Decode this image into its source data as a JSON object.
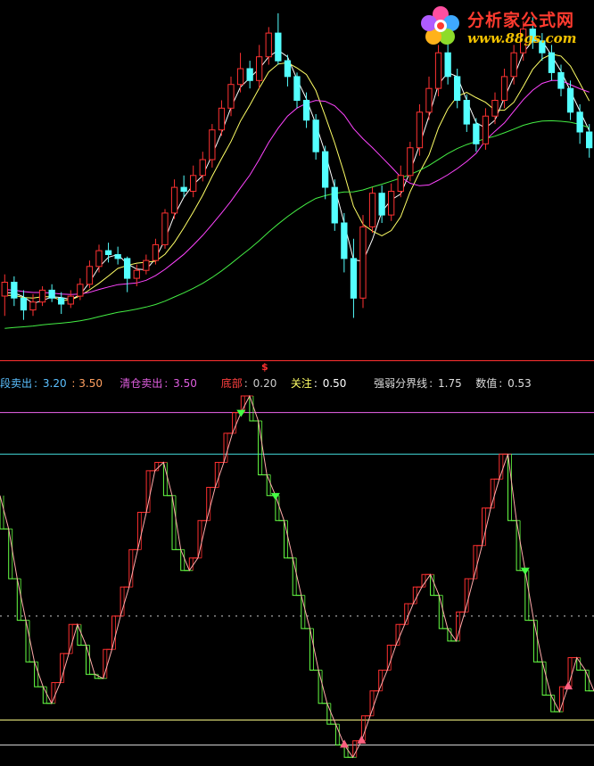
{
  "watermark": {
    "title": "分析家公式网",
    "url": "www.88gs.com",
    "colors": {
      "title": "#ff3b2f",
      "url": "#f2c200"
    }
  },
  "marker": {
    "symbol": "$"
  },
  "indicator": {
    "legend": [
      {
        "label": "段卖出",
        "sep": ": ",
        "value": "3.20",
        "extra": ": 3.50",
        "label_color": "#5bc0ff",
        "value_color": "#5bc0ff"
      },
      {
        "label": "清仓卖出",
        "sep": ": ",
        "value": "3.50",
        "label_color": "#e05ee0",
        "value_color": "#e05ee0"
      },
      {
        "label": "底部",
        "sep": ": ",
        "value": "0.20",
        "label_color": "#ff4040",
        "value_color": "#cccccc"
      },
      {
        "label": "关注",
        "sep": ": ",
        "value": "0.50",
        "label_color": "#ffff66",
        "value_color": "#ffffff"
      },
      {
        "label": "强弱分界线",
        "sep": ": ",
        "value": "1.75",
        "label_color": "#dddddd",
        "value_color": "#dddddd"
      },
      {
        "label": "数值",
        "sep": ": ",
        "value": "0.53",
        "label_color": "#dddddd",
        "value_color": "#dddddd"
      }
    ]
  },
  "chart_data": [
    {
      "type": "candlestick",
      "colors": {
        "up": "#ff3232",
        "down": "#54ffff",
        "ma_white": "#ffffff",
        "ma_yellow": "#ffff66",
        "ma_magenta": "#ff44ff",
        "ma_green": "#44ee44"
      },
      "candles": [
        {
          "o": 5.3,
          "c": 6.0,
          "h": 6.4,
          "l": 4.3
        },
        {
          "o": 6.0,
          "c": 5.2,
          "h": 6.3,
          "l": 4.8
        },
        {
          "o": 5.2,
          "c": 4.6,
          "h": 5.6,
          "l": 4.1
        },
        {
          "o": 4.6,
          "c": 5.0,
          "h": 5.4,
          "l": 4.3
        },
        {
          "o": 5.0,
          "c": 5.6,
          "h": 5.8,
          "l": 4.8
        },
        {
          "o": 5.6,
          "c": 5.2,
          "h": 5.9,
          "l": 5.0
        },
        {
          "o": 5.2,
          "c": 4.9,
          "h": 5.5,
          "l": 4.4
        },
        {
          "o": 4.9,
          "c": 5.3,
          "h": 5.6,
          "l": 4.7
        },
        {
          "o": 5.3,
          "c": 5.9,
          "h": 6.2,
          "l": 5.1
        },
        {
          "o": 5.9,
          "c": 6.8,
          "h": 7.1,
          "l": 5.7
        },
        {
          "o": 6.8,
          "c": 7.6,
          "h": 7.9,
          "l": 6.5
        },
        {
          "o": 7.6,
          "c": 7.4,
          "h": 8.0,
          "l": 7.0
        },
        {
          "o": 7.4,
          "c": 7.2,
          "h": 7.8,
          "l": 6.9
        },
        {
          "o": 7.2,
          "c": 6.2,
          "h": 7.3,
          "l": 5.5
        },
        {
          "o": 6.2,
          "c": 6.6,
          "h": 6.9,
          "l": 5.8
        },
        {
          "o": 6.6,
          "c": 7.1,
          "h": 7.4,
          "l": 6.4
        },
        {
          "o": 7.1,
          "c": 7.9,
          "h": 8.2,
          "l": 6.9
        },
        {
          "o": 7.9,
          "c": 9.5,
          "h": 9.7,
          "l": 7.7
        },
        {
          "o": 9.5,
          "c": 10.8,
          "h": 11.2,
          "l": 9.2
        },
        {
          "o": 10.8,
          "c": 10.6,
          "h": 11.4,
          "l": 10.3
        },
        {
          "o": 10.6,
          "c": 11.4,
          "h": 11.9,
          "l": 10.3
        },
        {
          "o": 11.4,
          "c": 12.2,
          "h": 12.6,
          "l": 11.1
        },
        {
          "o": 12.2,
          "c": 13.7,
          "h": 14.0,
          "l": 11.8
        },
        {
          "o": 13.7,
          "c": 14.8,
          "h": 15.2,
          "l": 13.4
        },
        {
          "o": 14.8,
          "c": 16.0,
          "h": 16.4,
          "l": 14.4
        },
        {
          "o": 16.0,
          "c": 16.8,
          "h": 17.6,
          "l": 15.6
        },
        {
          "o": 16.8,
          "c": 16.2,
          "h": 17.2,
          "l": 15.8
        },
        {
          "o": 16.2,
          "c": 17.4,
          "h": 18.0,
          "l": 15.8
        },
        {
          "o": 17.4,
          "c": 18.6,
          "h": 18.9,
          "l": 17.0
        },
        {
          "o": 18.6,
          "c": 17.2,
          "h": 19.6,
          "l": 17.0
        },
        {
          "o": 17.2,
          "c": 16.4,
          "h": 17.5,
          "l": 15.9
        },
        {
          "o": 16.4,
          "c": 15.2,
          "h": 16.6,
          "l": 14.8
        },
        {
          "o": 15.2,
          "c": 14.2,
          "h": 15.6,
          "l": 13.8
        },
        {
          "o": 14.2,
          "c": 12.6,
          "h": 14.5,
          "l": 12.2
        },
        {
          "o": 12.6,
          "c": 10.8,
          "h": 12.9,
          "l": 10.2
        },
        {
          "o": 10.8,
          "c": 9.0,
          "h": 11.2,
          "l": 8.6
        },
        {
          "o": 9.0,
          "c": 7.2,
          "h": 9.5,
          "l": 6.5
        },
        {
          "o": 7.2,
          "c": 5.2,
          "h": 8.2,
          "l": 4.2
        },
        {
          "o": 5.2,
          "c": 8.8,
          "h": 9.4,
          "l": 4.7
        },
        {
          "o": 8.8,
          "c": 10.5,
          "h": 10.8,
          "l": 8.5
        },
        {
          "o": 10.5,
          "c": 9.4,
          "h": 10.9,
          "l": 9.0
        },
        {
          "o": 9.4,
          "c": 10.6,
          "h": 11.0,
          "l": 9.1
        },
        {
          "o": 10.6,
          "c": 11.4,
          "h": 11.9,
          "l": 10.3
        },
        {
          "o": 11.4,
          "c": 12.8,
          "h": 13.1,
          "l": 11.1
        },
        {
          "o": 12.8,
          "c": 14.6,
          "h": 15.0,
          "l": 12.4
        },
        {
          "o": 14.6,
          "c": 15.8,
          "h": 16.4,
          "l": 14.2
        },
        {
          "o": 15.8,
          "c": 17.6,
          "h": 18.0,
          "l": 15.4
        },
        {
          "o": 17.6,
          "c": 16.4,
          "h": 18.2,
          "l": 16.0
        },
        {
          "o": 16.4,
          "c": 15.2,
          "h": 16.8,
          "l": 14.8
        },
        {
          "o": 15.2,
          "c": 14.0,
          "h": 15.5,
          "l": 13.6
        },
        {
          "o": 14.0,
          "c": 13.0,
          "h": 14.3,
          "l": 12.6
        },
        {
          "o": 13.0,
          "c": 14.4,
          "h": 14.8,
          "l": 12.7
        },
        {
          "o": 14.4,
          "c": 15.2,
          "h": 15.6,
          "l": 14.0
        },
        {
          "o": 15.2,
          "c": 16.4,
          "h": 16.8,
          "l": 14.8
        },
        {
          "o": 16.4,
          "c": 17.6,
          "h": 18.0,
          "l": 16.0
        },
        {
          "o": 17.6,
          "c": 18.8,
          "h": 19.2,
          "l": 17.2
        },
        {
          "o": 18.8,
          "c": 18.2,
          "h": 19.4,
          "l": 17.8
        },
        {
          "o": 18.2,
          "c": 17.6,
          "h": 18.6,
          "l": 17.2
        },
        {
          "o": 17.6,
          "c": 16.6,
          "h": 18.0,
          "l": 16.2
        },
        {
          "o": 16.6,
          "c": 15.8,
          "h": 17.0,
          "l": 15.4
        },
        {
          "o": 15.8,
          "c": 14.6,
          "h": 16.2,
          "l": 14.2
        },
        {
          "o": 14.6,
          "c": 13.6,
          "h": 15.0,
          "l": 13.0
        },
        {
          "o": 13.6,
          "c": 12.8,
          "h": 14.0,
          "l": 12.3
        }
      ]
    },
    {
      "type": "line",
      "colors": {
        "rise": "#ff3030",
        "fall": "#66ff44",
        "smooth": "#ffaaaa"
      },
      "values": [
        3.2,
        2.8,
        2.2,
        1.7,
        1.2,
        0.9,
        0.7,
        0.95,
        1.3,
        1.65,
        1.4,
        1.05,
        1.0,
        1.35,
        1.75,
        2.1,
        2.55,
        3.0,
        3.5,
        3.6,
        3.2,
        2.55,
        2.3,
        2.45,
        2.9,
        3.3,
        3.6,
        3.95,
        4.2,
        4.4,
        4.1,
        3.45,
        3.2,
        2.9,
        2.45,
        2.0,
        1.6,
        1.1,
        0.7,
        0.45,
        0.2,
        0.05,
        0.25,
        0.55,
        0.85,
        1.1,
        1.4,
        1.65,
        1.9,
        2.1,
        2.25,
        2.0,
        1.6,
        1.45,
        1.8,
        2.2,
        2.6,
        3.05,
        3.4,
        3.7,
        2.9,
        2.3,
        1.7,
        1.2,
        0.8,
        0.6,
        0.9,
        1.25,
        1.1,
        0.85
      ],
      "ref_lines": [
        4.2,
        3.7,
        1.75,
        0.5,
        0.2
      ],
      "signals": [
        {
          "index": 28,
          "kind": "sell"
        },
        {
          "index": 32,
          "kind": "sell"
        },
        {
          "index": 61,
          "kind": "sell"
        },
        {
          "index": 40,
          "kind": "buy"
        },
        {
          "index": 42,
          "kind": "buy"
        },
        {
          "index": 66,
          "kind": "buy"
        }
      ]
    }
  ]
}
